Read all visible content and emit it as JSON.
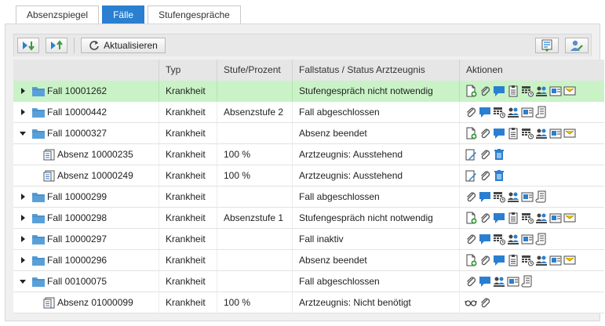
{
  "tabs": [
    {
      "label": "Absenzspiegel",
      "active": false
    },
    {
      "label": "Fälle",
      "active": true
    },
    {
      "label": "Stufengespräche",
      "active": false
    }
  ],
  "toolbar": {
    "refresh_label": "Aktualisieren"
  },
  "columns": {
    "name": "",
    "type": "Typ",
    "level": "Stufe/Prozent",
    "status": "Fallstatus / Status Arztzeugnis",
    "actions": "Aktionen"
  },
  "rows": [
    {
      "name": "Fall 10001262",
      "type": "Krankheit",
      "level": "",
      "status": "Stufengespräch nicht notwendig",
      "kind": "fall",
      "expander": "right",
      "highlight": true,
      "actions": [
        "new-document",
        "attach",
        "comment",
        "clipboard",
        "calendar",
        "people",
        "contact",
        "mail"
      ]
    },
    {
      "name": "Fall 10000442",
      "type": "Krankheit",
      "level": "Absenzstufe 2",
      "status": "Fall abgeschlossen",
      "kind": "fall",
      "expander": "right",
      "highlight": false,
      "actions": [
        "attach",
        "comment",
        "calendar",
        "people",
        "contact",
        "scroll"
      ]
    },
    {
      "name": "Fall 10000327",
      "type": "Krankheit",
      "level": "",
      "status": "Absenz beendet",
      "kind": "fall",
      "expander": "down",
      "highlight": false,
      "actions": [
        "new-document",
        "attach",
        "comment",
        "clipboard",
        "calendar",
        "people",
        "contact",
        "mail"
      ]
    },
    {
      "name": "Absenz 10000235",
      "type": "Krankheit",
      "level": "100 %",
      "status": "Arztzeugnis: Ausstehend",
      "kind": "absenz",
      "expander": "none",
      "highlight": false,
      "actions": [
        "edit",
        "attach",
        "trash"
      ]
    },
    {
      "name": "Absenz 10000249",
      "type": "Krankheit",
      "level": "100 %",
      "status": "Arztzeugnis: Ausstehend",
      "kind": "absenz",
      "expander": "none",
      "highlight": false,
      "actions": [
        "edit",
        "attach",
        "trash"
      ]
    },
    {
      "name": "Fall 10000299",
      "type": "Krankheit",
      "level": "",
      "status": "Fall abgeschlossen",
      "kind": "fall",
      "expander": "right",
      "highlight": false,
      "actions": [
        "attach",
        "comment",
        "calendar",
        "people",
        "contact",
        "scroll"
      ]
    },
    {
      "name": "Fall 10000298",
      "type": "Krankheit",
      "level": "Absenzstufe 1",
      "status": "Stufengespräch nicht notwendig",
      "kind": "fall",
      "expander": "right",
      "highlight": false,
      "actions": [
        "new-document",
        "attach",
        "comment",
        "clipboard",
        "calendar",
        "people",
        "contact",
        "mail"
      ]
    },
    {
      "name": "Fall 10000297",
      "type": "Krankheit",
      "level": "",
      "status": "Fall inaktiv",
      "kind": "fall",
      "expander": "right",
      "highlight": false,
      "actions": [
        "attach",
        "comment",
        "calendar",
        "people",
        "contact",
        "scroll"
      ]
    },
    {
      "name": "Fall 10000296",
      "type": "Krankheit",
      "level": "",
      "status": "Absenz beendet",
      "kind": "fall",
      "expander": "right",
      "highlight": false,
      "actions": [
        "new-document",
        "attach",
        "comment",
        "clipboard",
        "calendar",
        "people",
        "contact",
        "mail"
      ]
    },
    {
      "name": "Fall 00100075",
      "type": "Krankheit",
      "level": "",
      "status": "Fall abgeschlossen",
      "kind": "fall",
      "expander": "down",
      "highlight": false,
      "actions": [
        "attach",
        "comment",
        "people",
        "contact",
        "scroll"
      ]
    },
    {
      "name": "Absenz 01000099",
      "type": "Krankheit",
      "level": "100 %",
      "status": "Arztzeugnis: Nicht benötigt",
      "kind": "absenz",
      "expander": "none",
      "highlight": false,
      "actions": [
        "glasses",
        "attach"
      ]
    }
  ],
  "colors": {
    "active_tab": "#2a7fd0",
    "highlight_row": "#c9f3c6",
    "folder": "#5aa0d8",
    "trash": "#2a7fd0"
  }
}
